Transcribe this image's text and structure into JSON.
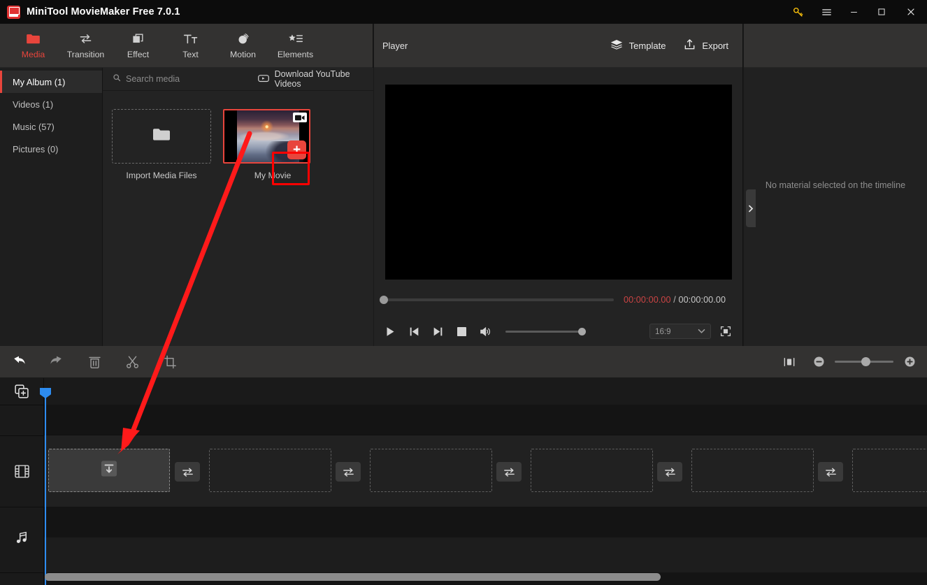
{
  "window": {
    "title": "MiniTool MovieMaker Free 7.0.1",
    "logo_icon": "app-logo-icon",
    "controls": [
      {
        "name": "key-icon",
        "glyph": "key"
      },
      {
        "name": "menu-icon",
        "glyph": "hamburger"
      },
      {
        "name": "minimize-icon",
        "glyph": "minimize"
      },
      {
        "name": "maximize-icon",
        "glyph": "maximize"
      },
      {
        "name": "close-icon",
        "glyph": "close"
      }
    ]
  },
  "toolbar": {
    "tabs": [
      {
        "label": "Media",
        "icon": "folder-icon",
        "active": true
      },
      {
        "label": "Transition",
        "icon": "transition-icon",
        "active": false
      },
      {
        "label": "Effect",
        "icon": "effect-icon",
        "active": false
      },
      {
        "label": "Text",
        "icon": "text-icon",
        "active": false
      },
      {
        "label": "Motion",
        "icon": "motion-icon",
        "active": false
      },
      {
        "label": "Elements",
        "icon": "elements-icon",
        "active": false
      }
    ]
  },
  "library": {
    "categories": [
      {
        "label": "My Album (1)",
        "active": true
      },
      {
        "label": "Videos (1)",
        "active": false
      },
      {
        "label": "Music (57)",
        "active": false
      },
      {
        "label": "Pictures (0)",
        "active": false
      }
    ],
    "search_placeholder": "Search media",
    "download_youtube_label": "Download YouTube Videos",
    "import_label": "Import Media Files",
    "items": [
      {
        "label": "My Movie",
        "type": "video",
        "selected": true,
        "add_button": "+"
      }
    ]
  },
  "player": {
    "title": "Player",
    "template_label": "Template",
    "export_label": "Export",
    "current_time": "00:00:00.00",
    "separator": "/",
    "total_time": "00:00:00.00",
    "aspect_ratio": "16:9",
    "controls": [
      {
        "name": "play-button",
        "icon": "play-icon"
      },
      {
        "name": "previous-frame-button",
        "icon": "skip-back-icon"
      },
      {
        "name": "next-frame-button",
        "icon": "skip-forward-icon"
      },
      {
        "name": "stop-button",
        "icon": "stop-icon"
      },
      {
        "name": "volume-button",
        "icon": "volume-icon"
      }
    ]
  },
  "properties": {
    "empty_message": "No material selected on the timeline"
  },
  "timeline": {
    "tools": [
      {
        "name": "undo-button",
        "icon": "undo-icon"
      },
      {
        "name": "redo-button",
        "icon": "redo-icon"
      },
      {
        "name": "delete-button",
        "icon": "trash-icon"
      },
      {
        "name": "split-button",
        "icon": "scissors-icon"
      },
      {
        "name": "crop-button",
        "icon": "crop-icon"
      }
    ],
    "fit_label": "fit-to-screen-icon",
    "zoom_out_label": "−",
    "zoom_in_label": "+",
    "tracks": [
      {
        "name": "video-track",
        "icon": "film-icon"
      },
      {
        "name": "audio-track",
        "icon": "music-note-icon"
      }
    ],
    "slots": [
      {
        "index": 1,
        "filled": true,
        "icon": "drop-here-icon"
      },
      {
        "index": 2,
        "filled": false,
        "icon": ""
      },
      {
        "index": 3,
        "filled": false,
        "icon": ""
      },
      {
        "index": 4,
        "filled": false,
        "icon": ""
      },
      {
        "index": 5,
        "filled": false,
        "icon": ""
      },
      {
        "index": 6,
        "filled": false,
        "icon": ""
      }
    ],
    "transitions": [
      {
        "index": 1,
        "icon": "transition-icon"
      },
      {
        "index": 2,
        "icon": "transition-icon"
      },
      {
        "index": 3,
        "icon": "transition-icon"
      },
      {
        "index": 4,
        "icon": "transition-icon"
      },
      {
        "index": 5,
        "icon": "transition-icon"
      }
    ]
  },
  "annotation": {
    "arrow_color": "#ff1a1a",
    "highlight_color": "#ff0000",
    "description": "red arrow from media add button to first timeline slot"
  },
  "colors": {
    "accent_red": "#e8453c",
    "playhead_blue": "#2d8cf0",
    "key_yellow": "#f0b90b",
    "panel_header": "#333231",
    "panel_body": "#232323"
  }
}
